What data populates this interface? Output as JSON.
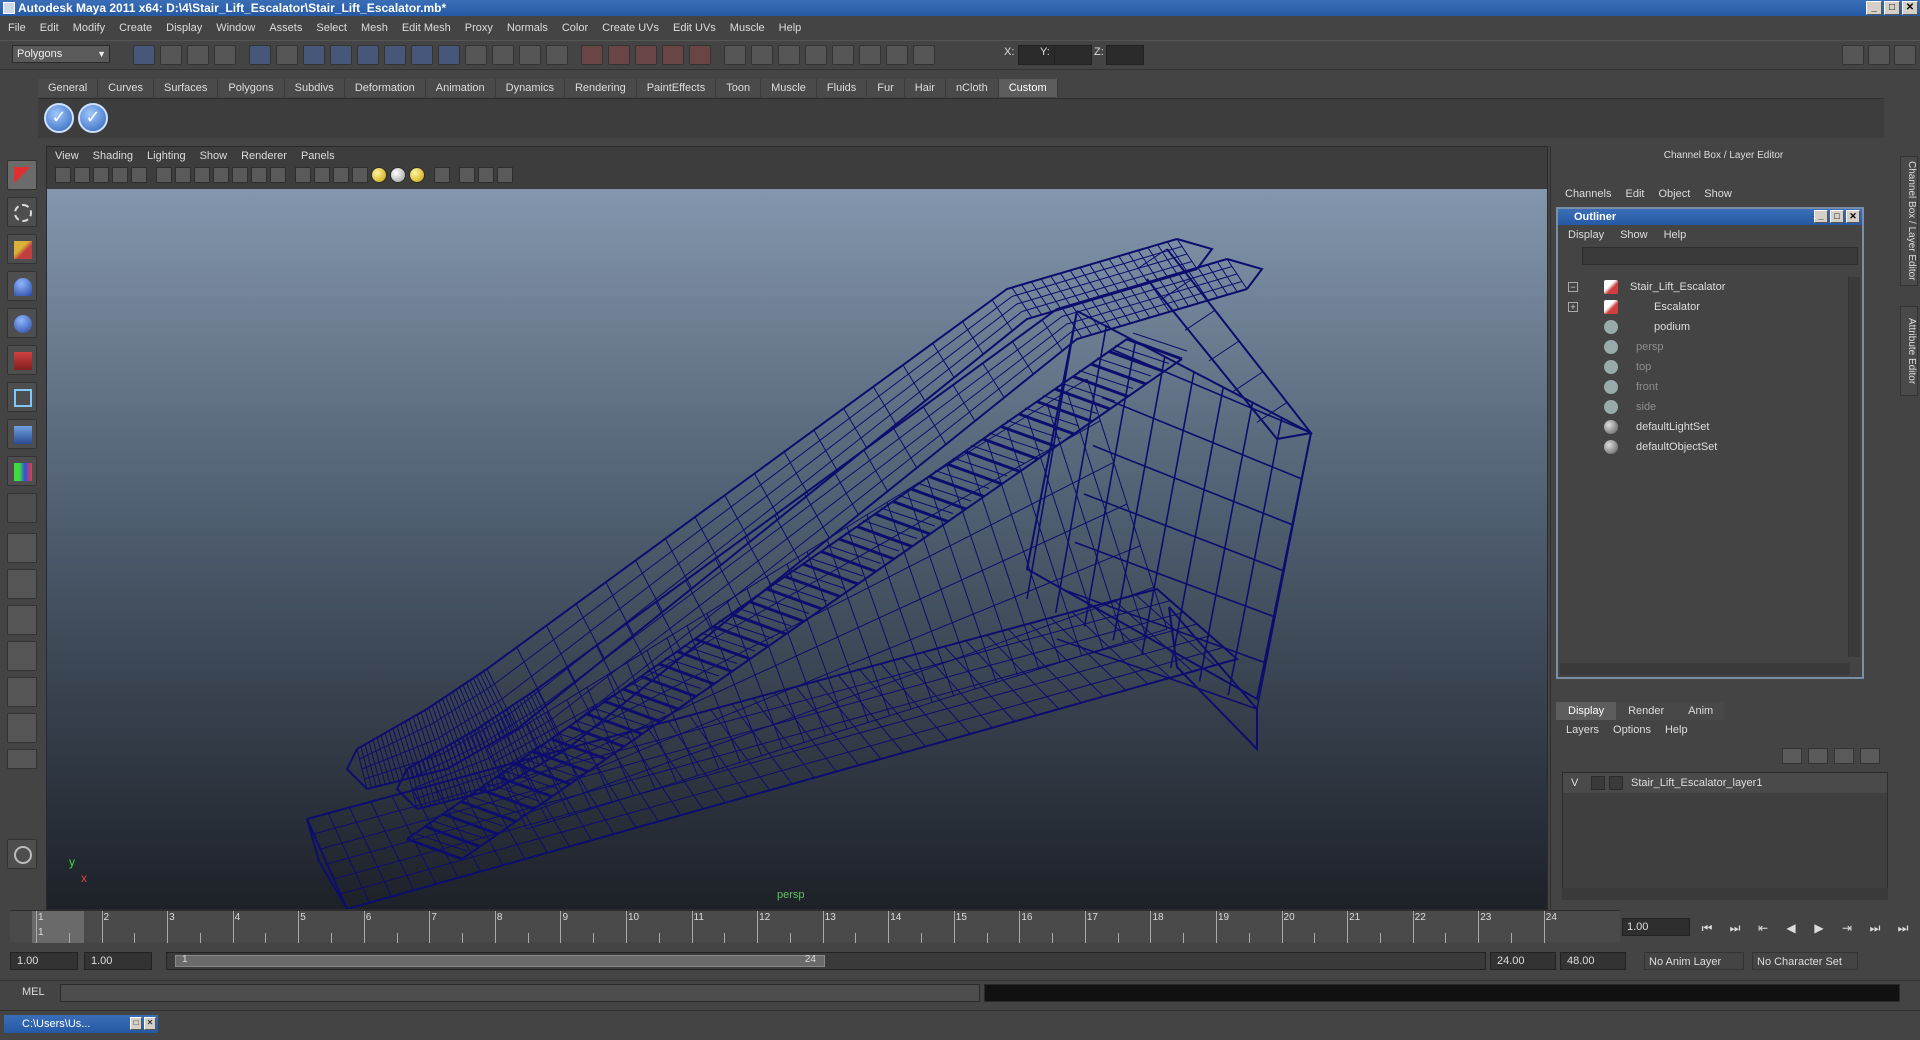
{
  "window": {
    "title": "Autodesk Maya 2011 x64: D:\\4\\Stair_Lift_Escalator\\Stair_Lift_Escalator.mb*",
    "min": "_",
    "max": "□",
    "close": "✕"
  },
  "menubar": [
    "File",
    "Edit",
    "Modify",
    "Create",
    "Display",
    "Window",
    "Assets",
    "Select",
    "Mesh",
    "Edit Mesh",
    "Proxy",
    "Normals",
    "Color",
    "Create UVs",
    "Edit UVs",
    "Muscle",
    "Help"
  ],
  "statusline": {
    "mode": "Polygons",
    "x_label": "X:",
    "y_label": "Y:",
    "z_label": "Z:"
  },
  "shelf": {
    "tabs": [
      "General",
      "Curves",
      "Surfaces",
      "Polygons",
      "Subdivs",
      "Deformation",
      "Animation",
      "Dynamics",
      "Rendering",
      "PaintEffects",
      "Toon",
      "Muscle",
      "Fluids",
      "Fur",
      "Hair",
      "nCloth",
      "Custom"
    ],
    "active_tab": "Custom",
    "button_glyph": "✓"
  },
  "viewport": {
    "menu": [
      "View",
      "Shading",
      "Lighting",
      "Show",
      "Renderer",
      "Panels"
    ],
    "camera": "persp",
    "axis_y": "y",
    "axis_x": "x",
    "wire_color": "#0d0d6e"
  },
  "channel_box": {
    "title": "Channel Box / Layer Editor",
    "menu": [
      "Channels",
      "Edit",
      "Object",
      "Show"
    ]
  },
  "outliner": {
    "title": "Outliner",
    "menu": [
      "Display",
      "Show",
      "Help"
    ],
    "items": [
      {
        "label": "Stair_Lift_Escalator",
        "expander": "−"
      },
      {
        "label": "Escalator",
        "expander": "+"
      },
      {
        "label": "podium"
      },
      {
        "label": "persp"
      },
      {
        "label": "top"
      },
      {
        "label": "front"
      },
      {
        "label": "side"
      },
      {
        "label": "defaultLightSet"
      },
      {
        "label": "defaultObjectSet"
      }
    ]
  },
  "layer_editor": {
    "tabs": [
      "Display",
      "Render",
      "Anim"
    ],
    "active_tab": "Display",
    "menu": [
      "Layers",
      "Options",
      "Help"
    ],
    "layers": [
      {
        "visible": "V",
        "name": "Stair_Lift_Escalator_layer1"
      }
    ]
  },
  "side_tabs": [
    "Channel Box / Layer Editor",
    "Attribute Editor"
  ],
  "timeline": {
    "start": 1,
    "end": 24,
    "current_frame": "1.00",
    "current_marker": "1"
  },
  "playback": [
    "⏮",
    "⏭",
    "⇤",
    "◀",
    "▶",
    "⇥",
    "⏭",
    "⏭"
  ],
  "range": {
    "start": "1.00",
    "playback_start": "1.00",
    "bar_start": "1",
    "bar_end": "24",
    "playback_end": "24.00",
    "end": "48.00",
    "anim_layer": "No Anim Layer",
    "character_set": "No Character Set"
  },
  "command_line": {
    "label": "MEL"
  },
  "taskbar": {
    "item": "C:\\Users\\Us..."
  }
}
